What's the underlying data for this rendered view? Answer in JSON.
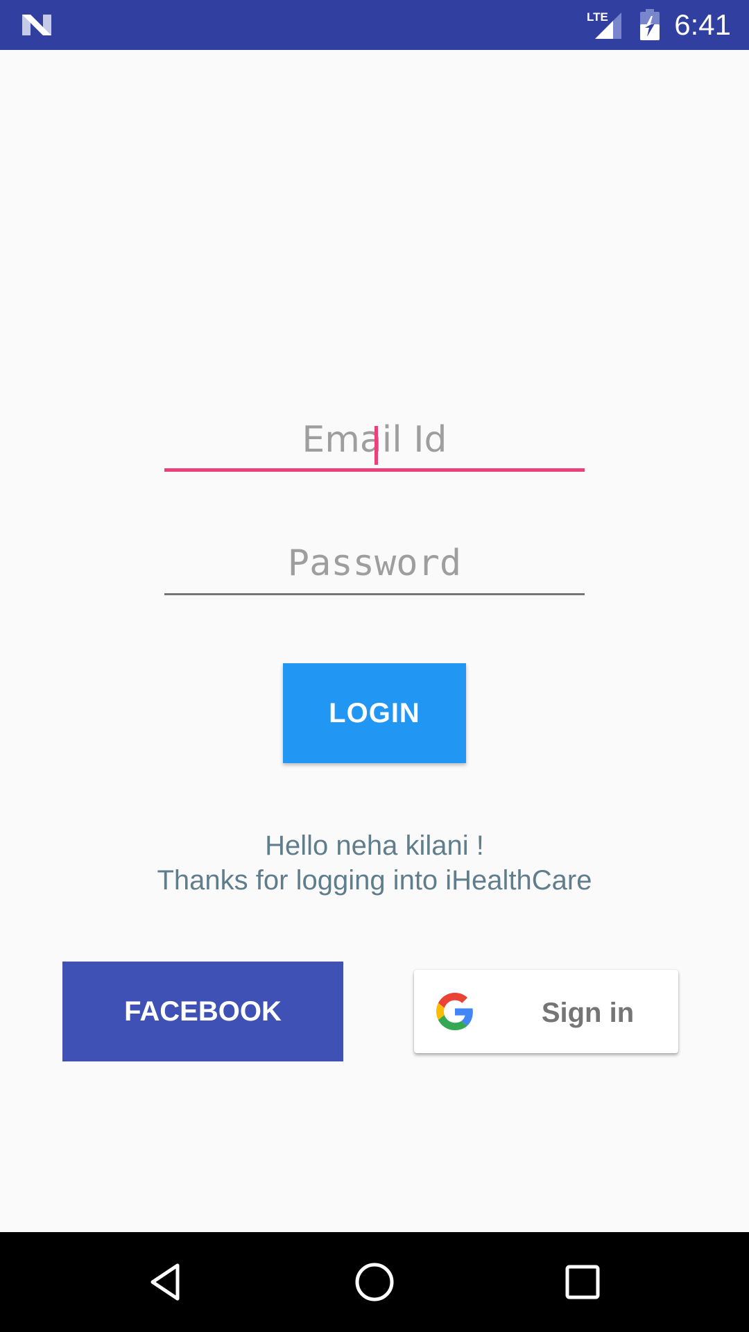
{
  "status_bar": {
    "time": "6:41",
    "network_label": "LTE",
    "icons": [
      "n-logo-icon",
      "lte-signal-icon",
      "battery-charging-icon"
    ],
    "color": "#3140a0"
  },
  "login_form": {
    "email": {
      "placeholder": "Email Id",
      "value": "",
      "focused": true,
      "accent_color": "#ec407a"
    },
    "password": {
      "placeholder": "Password",
      "value": ""
    },
    "login_button": {
      "label": "LOGIN",
      "color": "#2196f3"
    }
  },
  "welcome": {
    "line1": "Hello neha kilani !",
    "line2": "Thanks for logging into iHealthCare",
    "color": "#607d8b"
  },
  "social": {
    "facebook_button": {
      "label": "FACEBOOK",
      "color": "#3f51b5"
    },
    "google_button": {
      "label": "Sign in",
      "icon": "google-g-icon"
    }
  },
  "nav_bar": {
    "icons": [
      "back-icon",
      "home-icon",
      "recents-icon"
    ]
  }
}
